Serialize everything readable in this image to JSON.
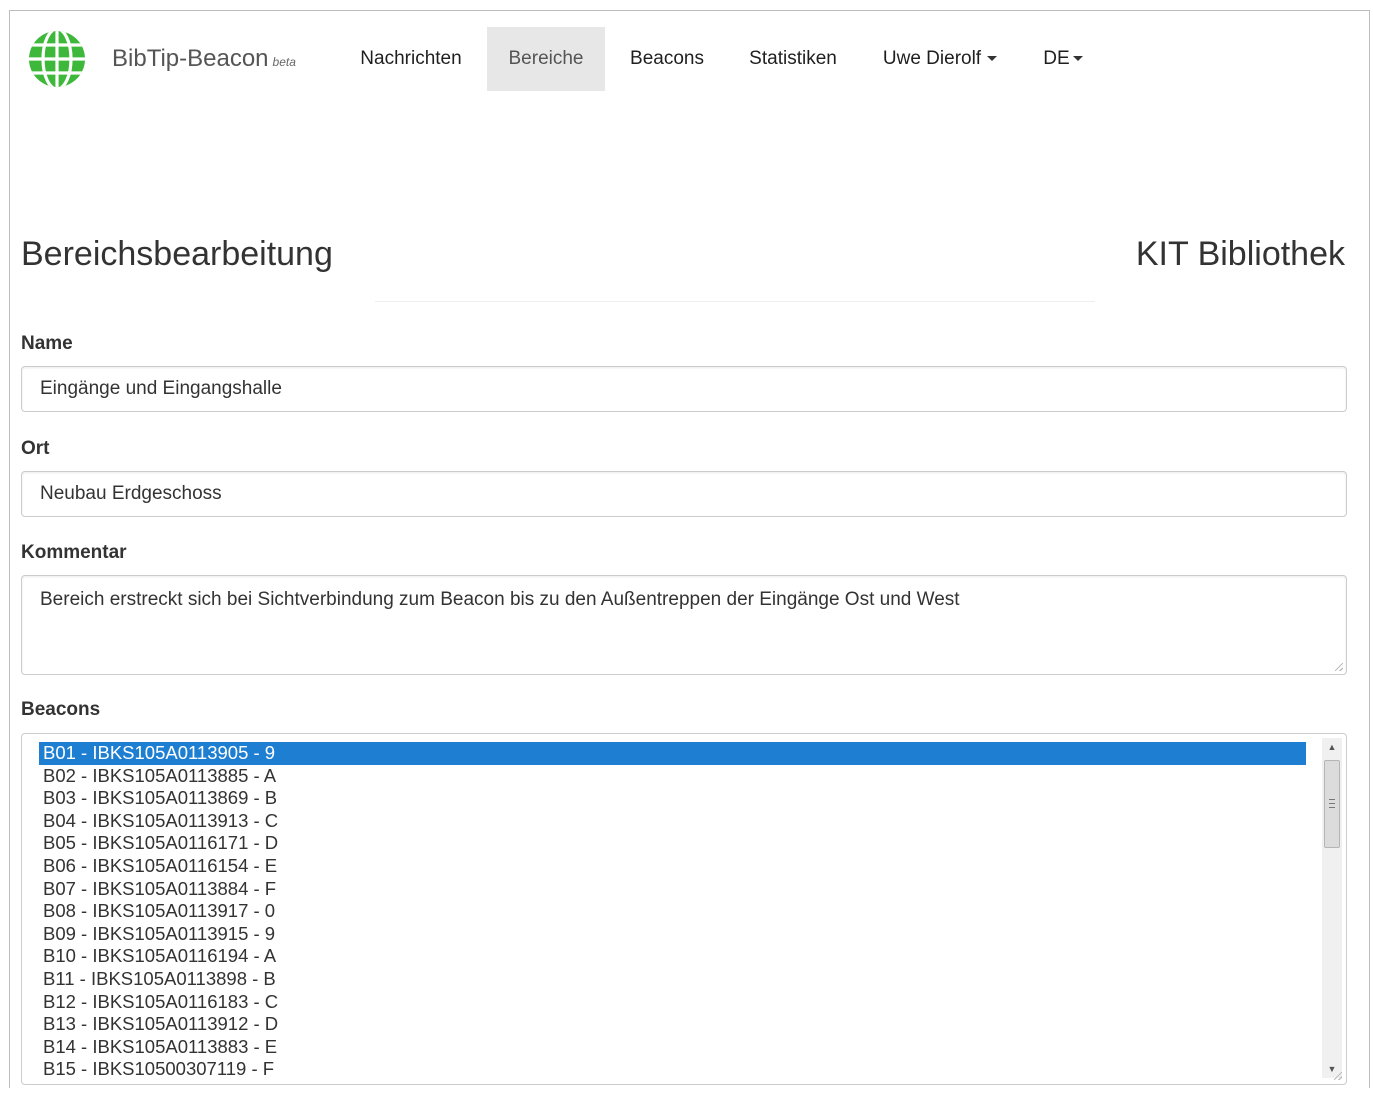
{
  "app": {
    "brand_name": "BibTip-Beacon",
    "brand_tag": "beta",
    "logo_icon": "globe-icon",
    "colors": {
      "logo_green": "#3db83a",
      "selection_blue": "#1e7fd2",
      "active_nav_bg": "#e7e7e7"
    }
  },
  "nav": {
    "messages": "Nachrichten",
    "areas": "Bereiche",
    "beacons": "Beacons",
    "statistics": "Statistiken",
    "user": "Uwe Dierolf",
    "language": "DE",
    "active": "Bereiche"
  },
  "page": {
    "title": "Bereichsbearbeitung",
    "library": "KIT Bibliothek"
  },
  "form": {
    "name_label": "Name",
    "name_value": "Eingänge und Eingangshalle",
    "location_label": "Ort",
    "location_value": "Neubau Erdgeschoss",
    "comment_label": "Kommentar",
    "comment_value": "Bereich erstreckt sich bei Sichtverbindung zum Beacon bis zu den Außentreppen der Eingänge Ost und West",
    "beacons_label": "Beacons"
  },
  "beacons": {
    "selected_index": 0,
    "items": [
      "B01 - IBKS105A0113905 - 9",
      "B02 - IBKS105A0113885 - A",
      "B03 - IBKS105A0113869 - B",
      "B04 - IBKS105A0113913 - C",
      "B05 - IBKS105A0116171 - D",
      "B06 - IBKS105A0116154 - E",
      "B07 - IBKS105A0113884 - F",
      "B08 - IBKS105A0113917 - 0",
      "B09 - IBKS105A0113915 - 9",
      "B10 - IBKS105A0116194 - A",
      "B11 - IBKS105A0113898 - B",
      "B12 - IBKS105A0116183 - C",
      "B13 - IBKS105A0113912 - D",
      "B14 - IBKS105A0113883 - E",
      "B15 - IBKS10500307119 - F"
    ]
  }
}
